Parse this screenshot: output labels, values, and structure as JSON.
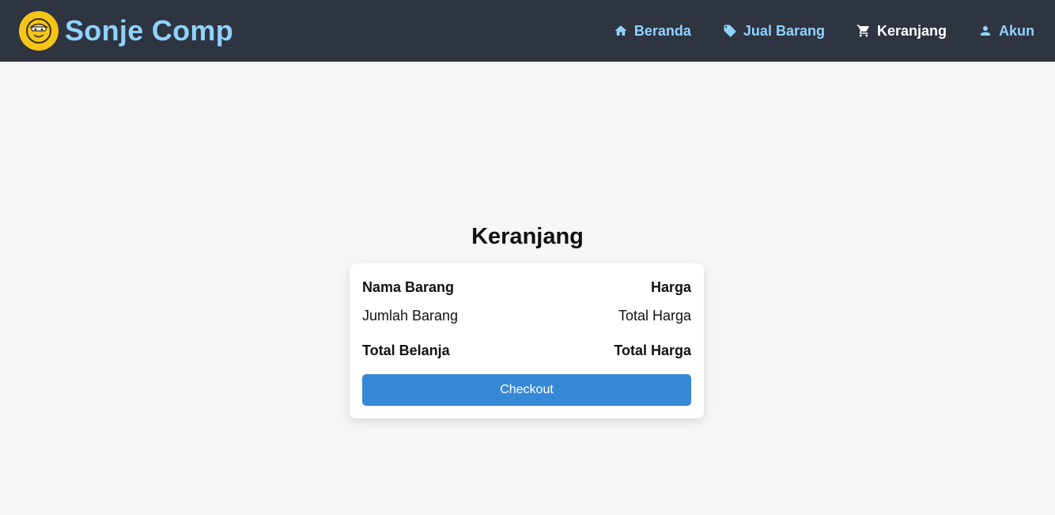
{
  "brand": {
    "name": "Sonje Comp",
    "logo_icon": "face-logo-icon"
  },
  "nav": {
    "items": [
      {
        "label": "Beranda",
        "icon": "home-icon",
        "active": false
      },
      {
        "label": "Jual Barang",
        "icon": "tag-icon",
        "active": false
      },
      {
        "label": "Keranjang",
        "icon": "cart-icon",
        "active": true
      },
      {
        "label": "Akun",
        "icon": "person-icon",
        "active": false
      }
    ]
  },
  "page": {
    "title": "Keranjang"
  },
  "cart": {
    "header_left": "Nama Barang",
    "header_right": "Harga",
    "qty_left": "Jumlah Barang",
    "qty_right": "Total Harga",
    "total_left": "Total Belanja",
    "total_right": "Total Harga",
    "checkout_label": "Checkout"
  },
  "colors": {
    "navbar_bg": "#2f3441",
    "accent": "#8fd3fe",
    "button": "#3789d7",
    "logo": "#f5c518",
    "page_bg": "#f6f6f6"
  }
}
